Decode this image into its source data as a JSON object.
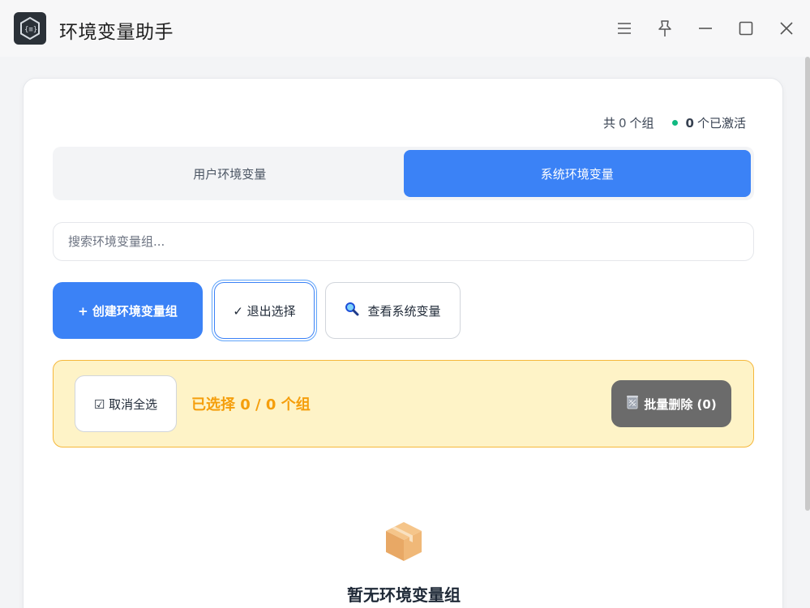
{
  "window": {
    "title": "环境变量助手",
    "icons": [
      "app-logo-icon",
      "menu-icon",
      "pin-icon",
      "minimize-icon",
      "maximize-icon",
      "close-icon"
    ]
  },
  "stats": {
    "total_prefix": "共",
    "total_count": "0",
    "total_suffix": "个组",
    "active_count": "0",
    "active_suffix": "个已激活",
    "active_color": "#10b981"
  },
  "tabs": [
    {
      "label": "用户环境变量",
      "active": false
    },
    {
      "label": "系统环境变量",
      "active": true
    }
  ],
  "search": {
    "placeholder": "搜索环境变量组...",
    "value": ""
  },
  "actions": {
    "create_label": "+ 创建环境变量组",
    "exit_select_label": "✓ 退出选择",
    "view_system_label": "查看系统变量",
    "view_system_icon": "magnifier-icon"
  },
  "selection": {
    "deselect_label": "☑ 取消全选",
    "selected_text": "已选择 0 / 0 个组",
    "batch_delete_label": "批量删除 (0)",
    "batch_delete_icon": "wastebasket-icon"
  },
  "empty_state": {
    "icon": "package-icon",
    "title": "暂无环境变量组"
  },
  "colors": {
    "accent": "#3b82f6",
    "warning_bg": "#fef3c7",
    "warning_text": "#f59e0b",
    "disabled_btn": "#6b6b6b"
  }
}
